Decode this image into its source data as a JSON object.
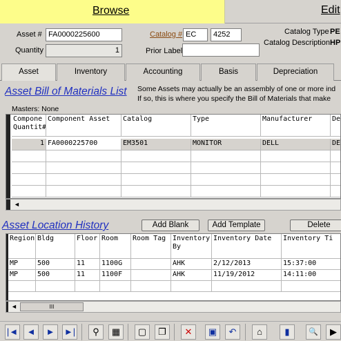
{
  "modebar": {
    "browse": "Browse",
    "edit": "Edit"
  },
  "header": {
    "asset_label": "Asset #",
    "asset_value": "FA0000225600",
    "catalog_label": "Catalog #",
    "catalog_code": "EC",
    "catalog_number": "4252",
    "catalog_type_label": "Catalog Type",
    "catalog_type_value": "PE",
    "quantity_label": "Quantity",
    "quantity_value": "1",
    "prior_label": "Prior Label",
    "prior_value": "",
    "catalog_desc_label": "Catalog Description",
    "catalog_desc_value": "HP"
  },
  "tabs": [
    "Asset",
    "Inventory",
    "Accounting",
    "Basis",
    "Depreciation"
  ],
  "bom": {
    "title": "Asset Bill of Materials List",
    "info_line1": "Some Assets may actually be an assembly of one or more ind",
    "info_line2": "If so, this is where you specify the Bill of Materials that make",
    "masters": "Masters: None",
    "columns": [
      "Compone Quantit#",
      "Component Asset",
      "Catalog",
      "Type",
      "Manufacturer",
      "De"
    ],
    "rows": [
      [
        "1",
        "FA0000225700",
        "EM3501",
        "MONITOR",
        "DELL",
        "DE"
      ]
    ]
  },
  "location": {
    "title": "Asset Location History",
    "add_blank": "Add Blank",
    "add_template": "Add Template",
    "delete": "Delete",
    "columns": [
      "Region",
      "Bldg",
      "Floor",
      "Room",
      "Room Tag",
      "Inventory By",
      "Inventory Date",
      "Inventory Ti"
    ],
    "rows": [
      [
        "MP",
        "500",
        "11",
        "1100G",
        "",
        "AHK",
        "2/12/2013",
        "15:37:00"
      ],
      [
        "MP",
        "500",
        "11",
        "1100F",
        "",
        "AHK",
        "11/19/2012",
        "14:11:00"
      ]
    ]
  },
  "scroll": {
    "thumb": "III",
    "left": "◄",
    "right": "►"
  },
  "toolbar": {
    "icons": [
      "first-record-icon",
      "previous-record-icon",
      "next-record-icon",
      "last-record-icon",
      "find-icon",
      "filter-icon",
      "new-record-icon",
      "copy-record-icon",
      "delete-record-icon",
      "save-icon",
      "undo-icon",
      "home-icon",
      "book-icon",
      "search-doc-icon",
      "exit-icon"
    ],
    "glyphs": [
      "|◄",
      "◄",
      "►",
      "►|",
      "⚲",
      "▦",
      "▢",
      "❐",
      "✕",
      "▣",
      "↶",
      "⌂",
      "▮",
      "🔍",
      "▶"
    ]
  }
}
